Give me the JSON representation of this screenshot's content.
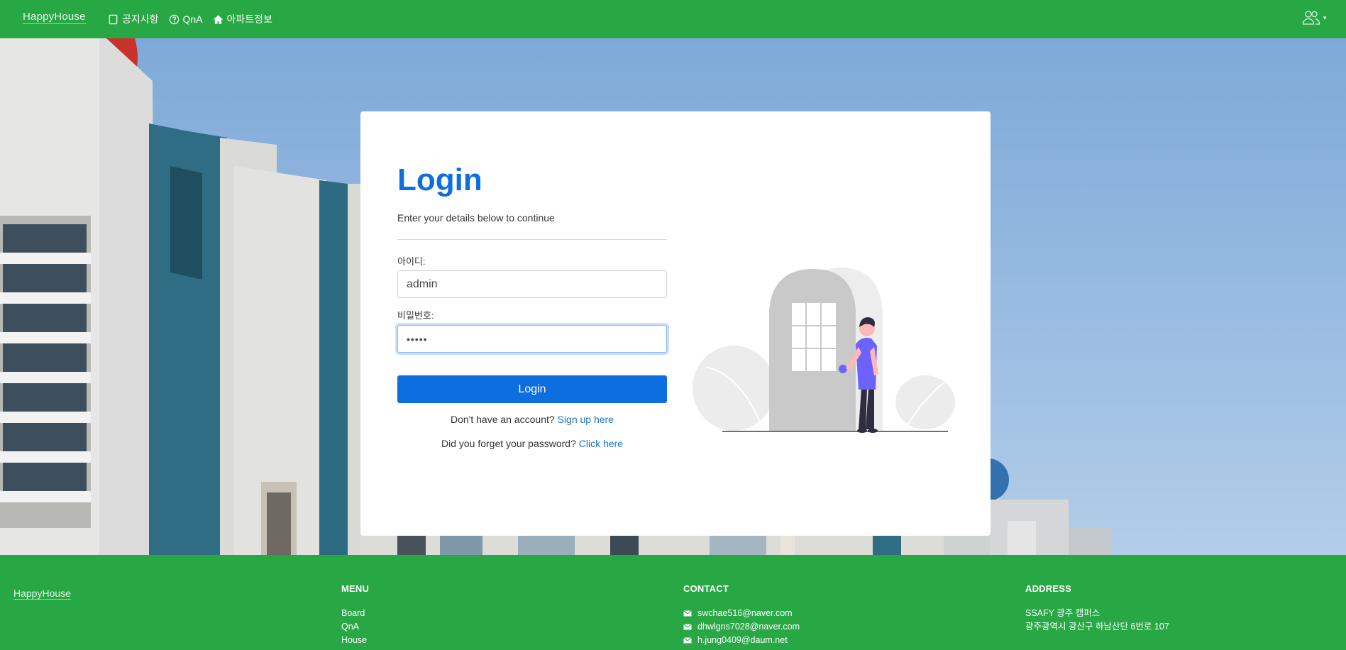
{
  "navbar": {
    "brand": "HappyHouse",
    "links": [
      {
        "label": "공지사항",
        "icon": "square-icon"
      },
      {
        "label": "QnA",
        "icon": "question-circle-icon"
      },
      {
        "label": "아파트정보",
        "icon": "house-icon"
      }
    ],
    "user_icon": "users-icon"
  },
  "login": {
    "title": "Login",
    "subtitle": "Enter your details below to continue",
    "id_label": "아이디:",
    "id_value": "admin",
    "password_label": "비밀번호:",
    "password_value": "•••••",
    "submit_label": "Login",
    "signup_prompt": "Don't have an account?",
    "signup_link": "Sign up here",
    "forgot_prompt": "Did you forget your password?",
    "forgot_link": "Click here"
  },
  "footer": {
    "brand": "HappyHouse",
    "menu": {
      "heading": "MENU",
      "items": [
        "Board",
        "QnA",
        "House"
      ]
    },
    "contact": {
      "heading": "CONTACT",
      "emails": [
        "swchae516@naver.com",
        "dhwlgns7028@naver.com",
        "h.jung0409@daum.net"
      ]
    },
    "address": {
      "heading": "ADDRESS",
      "lines": [
        "SSAFY 광주 캠퍼스",
        "광주광역시 광산구 하남산단 6번로 107"
      ]
    }
  },
  "colors": {
    "brand_green": "#28a745",
    "primary_blue": "#0d6fdf",
    "link_blue": "#1a73c9",
    "illustration_purple": "#6c63ff"
  }
}
